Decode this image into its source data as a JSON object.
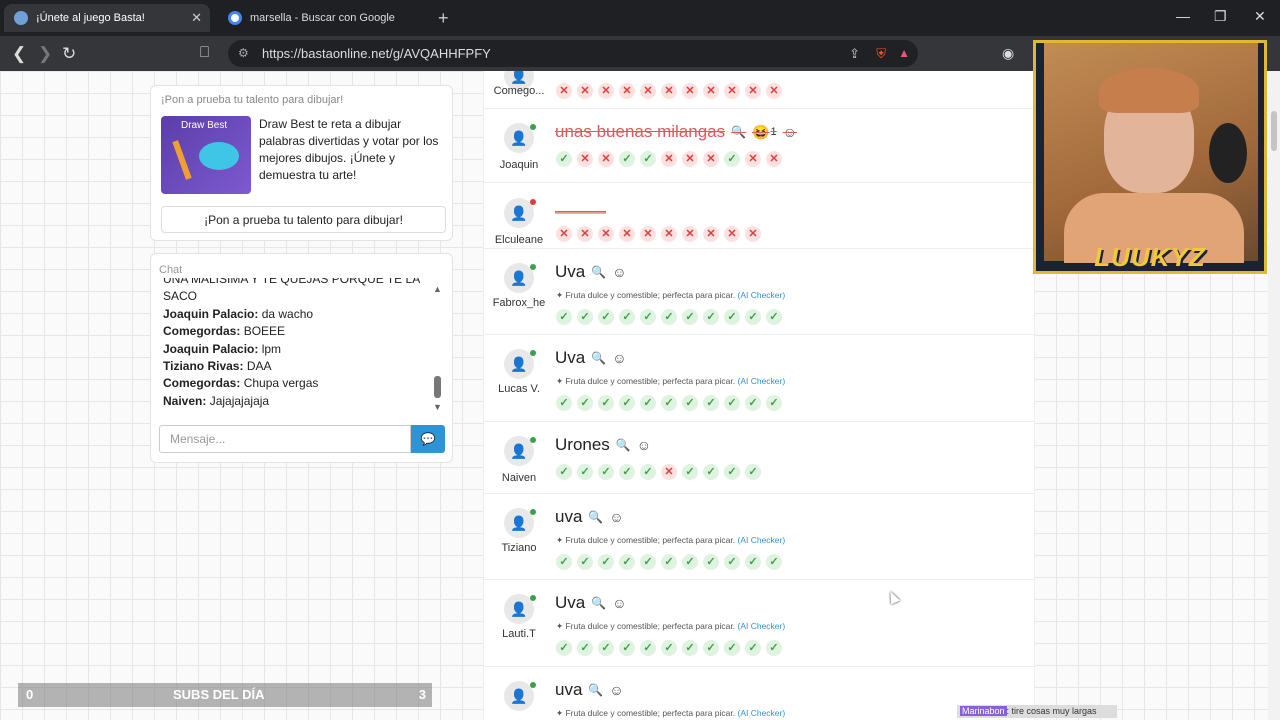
{
  "browser": {
    "tabs": [
      {
        "title": "¡Únete al juego Basta!",
        "active": true
      },
      {
        "title": "marsella - Buscar con Google",
        "active": false
      }
    ],
    "url": "https://bastaonline.net/g/AVQAHHFPFY"
  },
  "promo": {
    "heading": "¡Pon a prueba tu talento para dibujar!",
    "image_text": "Draw Best",
    "description": "Draw Best te reta a dibujar palabras divertidas y votar por los mejores dibujos. ¡Únete y demuestra tu arte!",
    "button": "¡Pon a prueba tu talento para dibujar!"
  },
  "chat": {
    "label": "Chat",
    "partial_top": "UNA MALISIMA Y TE QUEJAS PORQUE TE LA SACO",
    "messages": [
      {
        "user": "Joaquin Palacio:",
        "text": "da wacho"
      },
      {
        "user": "Comegordas:",
        "text": "BOEEE"
      },
      {
        "user": "Joaquin Palacio:",
        "text": "lpm"
      },
      {
        "user": "Tiziano Rivas:",
        "text": "DAA"
      },
      {
        "user": "Comegordas:",
        "text": "Chupa vergas"
      },
      {
        "user": "Naiven:",
        "text": "Jajajajajaja"
      }
    ],
    "placeholder": "Mensaje..."
  },
  "subs": {
    "left": "0",
    "label": "SUBS DEL DÍA",
    "right": "3"
  },
  "answers": [
    {
      "player": "Comego...",
      "answer": "",
      "votes": "xxxxxxxxxxx",
      "online": true
    },
    {
      "player": "Joaquin",
      "answer": "unas buenas milangas",
      "reaction": "😆",
      "reaction_count": "1",
      "votes": "oxxooxxxoxx",
      "online": true
    },
    {
      "player": "Elculeane",
      "answer": "———",
      "votes": "xxxxxxxxxx",
      "online": false
    },
    {
      "player": "Fabrox_he",
      "answer": "Uva",
      "note": "Fruta dulce y comestible; perfecta para picar.",
      "ai": "(AI Checker)",
      "votes": "ooooooooooo",
      "toggle": "on",
      "online": true
    },
    {
      "player": "Lucas V.",
      "answer": "Uva",
      "note": "Fruta dulce y comestible; perfecta para picar.",
      "ai": "(AI Checker)",
      "votes": "ooooooooooo",
      "toggle": "on",
      "online": true
    },
    {
      "player": "Naiven",
      "answer": "Urones",
      "votes": "oooooxoooo",
      "toggle": "off",
      "online": true
    },
    {
      "player": "Tiziano",
      "answer": "uva",
      "note": "Fruta dulce y comestible; perfecta para picar.",
      "ai": "(AI Checker)",
      "votes": "ooooooooooo",
      "toggle": "on",
      "online": true
    },
    {
      "player": "Lauti.T",
      "answer": "Uva",
      "note": "Fruta dulce y comestible; perfecta para picar.",
      "ai": "(AI Checker)",
      "votes": "ooooooooooo",
      "toggle": "on",
      "online": true
    },
    {
      "player": "",
      "answer": "uva",
      "note": "Fruta dulce y comestible; perfecta para picar.",
      "ai": "(AI Checker)",
      "votes": "",
      "online": true
    }
  ],
  "webcam": {
    "name": "LUUKYZ"
  },
  "ticker": {
    "user": "Marinabon",
    "text": ": tire cosas muy largas"
  },
  "colors": {
    "ok": "#3aa34a",
    "bad": "#e03c3c",
    "accent": "#2f94d6"
  }
}
